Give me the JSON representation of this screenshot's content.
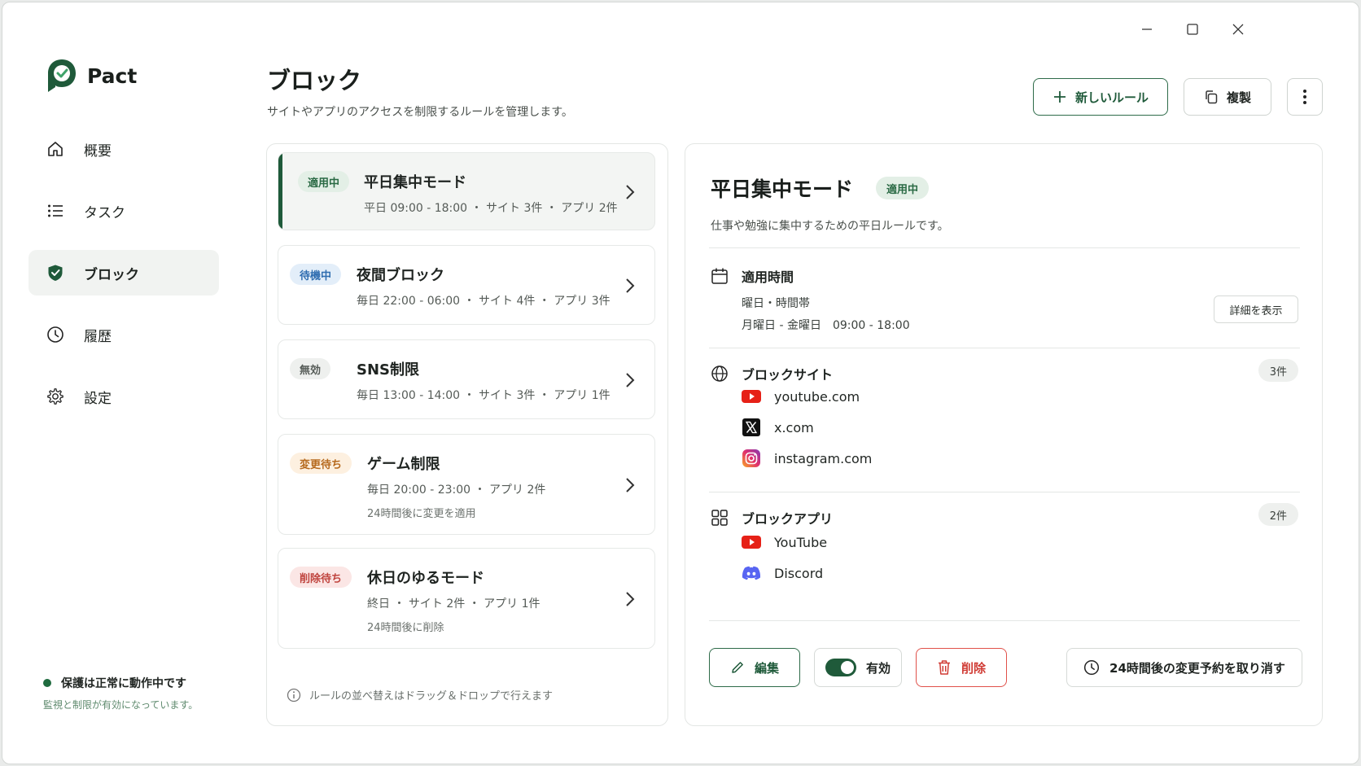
{
  "app": {
    "name": "Pact"
  },
  "sidebar": {
    "items": [
      {
        "label": "概要",
        "icon": "home-icon",
        "active": false
      },
      {
        "label": "タスク",
        "icon": "list-icon",
        "active": false
      },
      {
        "label": "ブロック",
        "icon": "shield-icon",
        "active": true
      },
      {
        "label": "履歴",
        "icon": "clock-icon",
        "active": false
      },
      {
        "label": "設定",
        "icon": "gear-icon",
        "active": false
      }
    ],
    "status": {
      "title": "保護は正常に動作中です",
      "subtitle": "監視と制限が有効になっています。"
    }
  },
  "header": {
    "title": "ブロック",
    "subtitle": "サイトやアプリのアクセスを制限するルールを管理します。",
    "new_rule_label": "新しいルール",
    "duplicate_label": "複製"
  },
  "rules": [
    {
      "badge": "適用中",
      "name": "平日集中モード",
      "meta": "平日 09:00 - 18:00 ・ サイト 3件 ・ アプリ 2件",
      "note": ""
    },
    {
      "badge": "待機中",
      "name": "夜間ブロック",
      "meta": "毎日 22:00 - 06:00 ・ サイト 4件 ・ アプリ 3件",
      "note": ""
    },
    {
      "badge": "無効",
      "name": "SNS制限",
      "meta": "毎日 13:00 - 14:00 ・ サイト 3件 ・ アプリ 1件",
      "note": ""
    },
    {
      "badge": "変更待ち",
      "name": "ゲーム制限",
      "meta": "毎日 20:00 - 23:00 ・ アプリ 2件",
      "note": "24時間後に変更を適用"
    },
    {
      "badge": "削除待ち",
      "name": "休日のゆるモード",
      "meta": "終日 ・ サイト 2件 ・ アプリ 1件",
      "note": "24時間後に削除"
    }
  ],
  "list_hint": "ルールの並べ替えはドラッグ＆ドロップで行えます",
  "detail": {
    "title": "平日集中モード",
    "badge": "適用中",
    "description": "仕事や勉強に集中するための平日ルールです。",
    "schedule": {
      "heading": "適用時間",
      "label": "曜日・時間帯",
      "value": "月曜日 - 金曜日　09:00 - 18:00",
      "details_button": "詳細を表示"
    },
    "sites": {
      "heading": "ブロックサイト",
      "count": "3件",
      "items": [
        {
          "label": "youtube.com",
          "icon": "youtube-icon"
        },
        {
          "label": "x.com",
          "icon": "x-icon"
        },
        {
          "label": "instagram.com",
          "icon": "instagram-icon"
        }
      ]
    },
    "apps": {
      "heading": "ブロックアプリ",
      "count": "2件",
      "items": [
        {
          "label": "YouTube",
          "icon": "youtube-icon"
        },
        {
          "label": "Discord",
          "icon": "discord-icon"
        }
      ]
    },
    "actions": {
      "edit": "編集",
      "toggle": "有効",
      "delete": "削除",
      "cancel_pending": "24時間後の変更予約を取り消す"
    }
  },
  "colors": {
    "brand": "#1f5a3a",
    "danger": "#d03c35",
    "youtube": "#e62117",
    "discord": "#5865f2"
  }
}
